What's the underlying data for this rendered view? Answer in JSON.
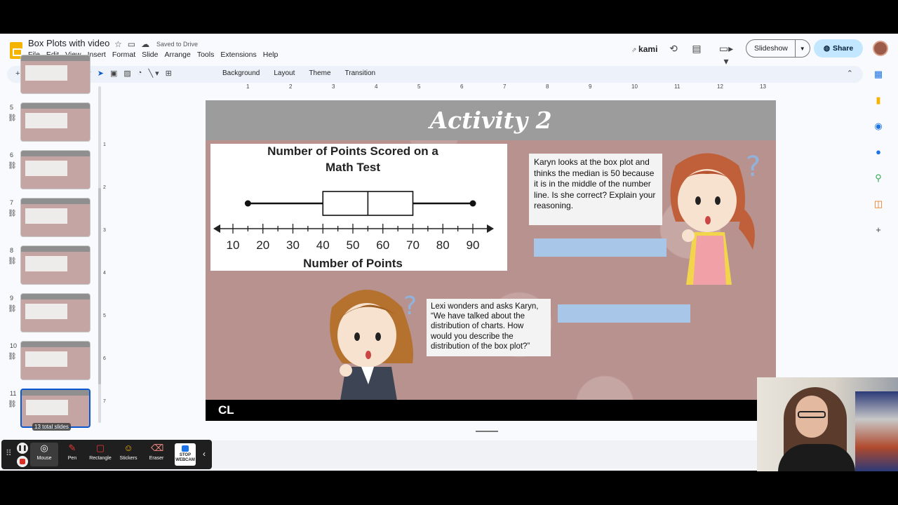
{
  "app": {
    "doc_title": "Box Plots with video",
    "saved_status": "Saved to Drive",
    "menu": [
      "File",
      "Edit",
      "View",
      "Insert",
      "Format",
      "Slide",
      "Arrange",
      "Tools",
      "Extensions",
      "Help"
    ],
    "kami_label": "kami",
    "slideshow_label": "Slideshow",
    "share_label": "Share",
    "brand_color": "#f4b400",
    "share_color": "#c2e7ff"
  },
  "toolbar": {
    "background": "Background",
    "layout": "Layout",
    "theme": "Theme",
    "transition": "Transition"
  },
  "ruler": {
    "h": [
      "1",
      "2",
      "3",
      "4",
      "5",
      "6",
      "7",
      "8",
      "9",
      "10",
      "11",
      "12",
      "13"
    ],
    "v": [
      "1",
      "2",
      "3",
      "4",
      "5",
      "6",
      "7"
    ]
  },
  "filmstrip": {
    "slides": [
      {
        "num": "5"
      },
      {
        "num": "6"
      },
      {
        "num": "7"
      },
      {
        "num": "8"
      },
      {
        "num": "9"
      },
      {
        "num": "10"
      },
      {
        "num": "11",
        "selected": true
      }
    ],
    "total": "13 total slides"
  },
  "slide": {
    "title": "Activity 2",
    "plot_title_line1": "Number of Points Scored on a",
    "plot_title_line2": "Math Test",
    "axis_label": "Number of Points",
    "karyn_text": "Karyn looks at the box plot and thinks the median is 50 because it is in the middle of the number line.  Is she correct?  Explain your reasoning.",
    "lexi_text": "Lexi wonders and asks Karyn, “We have talked about the distribution of charts.  How would you describe the distribution of the box plot?”",
    "footer_logo": "CL",
    "answer_box_color": "#a7c6e8"
  },
  "box_plot": {
    "ticks": [
      "10",
      "20",
      "30",
      "40",
      "50",
      "60",
      "70",
      "80",
      "90"
    ],
    "min": 15,
    "q1": 40,
    "median": 55,
    "q3": 70,
    "max": 90,
    "axis_min": 10,
    "axis_max": 90
  },
  "kami_toolbar": {
    "tools": [
      "Mouse",
      "Pen",
      "Rectangle",
      "Stickers",
      "Eraser"
    ],
    "stop_webcam_line1": "STOP",
    "stop_webcam_line2": "WEBCAM"
  }
}
